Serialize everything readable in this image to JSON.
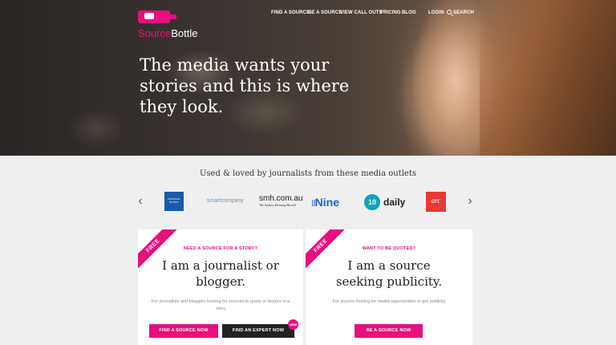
{
  "brand": {
    "name_part1": "Source",
    "name_part2": "Bottle"
  },
  "nav": {
    "items": [
      {
        "label": "FIND A SOURCE"
      },
      {
        "label": "BE A SOURCE"
      },
      {
        "label": "VIEW CALL OUTS"
      },
      {
        "label": "PRICING"
      },
      {
        "label": "BLOG"
      }
    ],
    "login": "LOGIN",
    "search": "SEARCH"
  },
  "hero": {
    "headline": "The media wants your stories and this is where they look."
  },
  "outlets": {
    "heading": "Used & loved by journalists from these media outlets",
    "logos": {
      "afr": "FINANCIAL REVIEW",
      "smart_a": "smart",
      "smart_b": "company",
      "smh_top": "smh.com.au",
      "smh_bottom": "The Sydney Morning Herald",
      "nine": "Nine",
      "ten_num": "10",
      "ten_word": "daily",
      "arc": "arc"
    }
  },
  "cards": {
    "journalist": {
      "ribbon": "FREE",
      "kicker": "NEED A SOURCE FOR A STORY?",
      "title": "I am a journalist or blogger.",
      "desc": "For journalists and bloggers looking for sources to quote or feature in a story",
      "btn_find": "FIND A SOURCE NOW",
      "btn_expert": "FIND AN EXPERT NOW",
      "badge": "NEW"
    },
    "source": {
      "ribbon": "FREE",
      "kicker": "WANT TO BE QUOTED?",
      "title": "I am a source seeking publicity.",
      "desc": "For anyone looking for media opportunities to get publicity",
      "btn": "BE A SOURCE NOW"
    }
  },
  "colors": {
    "accent": "#e6107f",
    "dark": "#222222"
  }
}
